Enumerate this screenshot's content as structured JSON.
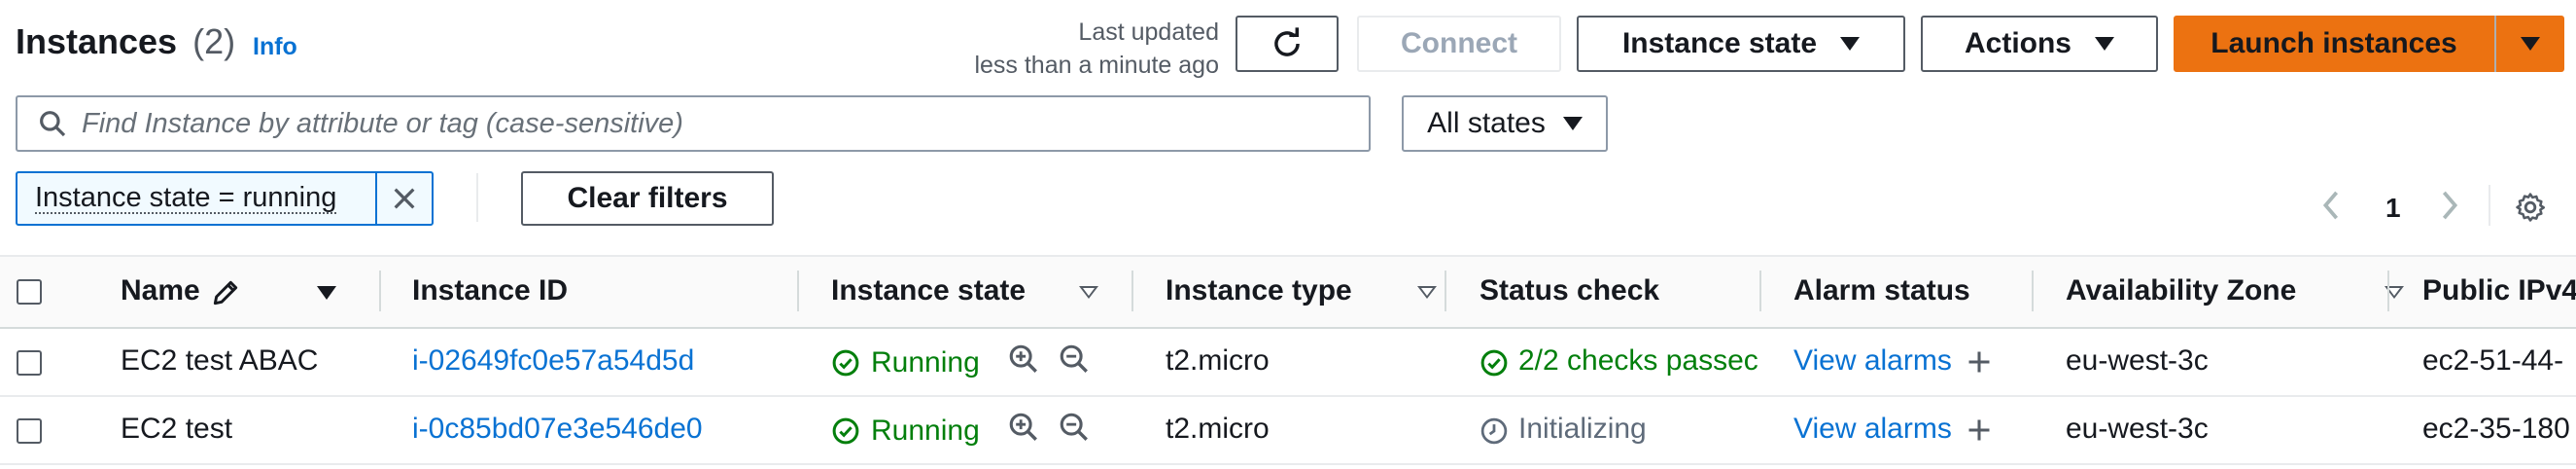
{
  "header": {
    "title": "Instances",
    "count": "(2)",
    "info": "Info",
    "last_updated_line1": "Last updated",
    "last_updated_line2": "less than a minute ago",
    "connect_label": "Connect",
    "instance_state_label": "Instance state",
    "actions_label": "Actions",
    "launch_label": "Launch instances"
  },
  "search": {
    "placeholder": "Find Instance by attribute or tag (case-sensitive)",
    "states_select": "All states"
  },
  "filters": {
    "token": "Instance state = running",
    "clear_label": "Clear filters"
  },
  "pagination": {
    "current_page": "1"
  },
  "table": {
    "columns": [
      "Name",
      "Instance ID",
      "Instance state",
      "Instance type",
      "Status check",
      "Alarm status",
      "Availability Zone",
      "Public IPv4"
    ],
    "rows": [
      {
        "name": "EC2 test ABAC",
        "instance_id": "i-02649fc0e57a54d5d",
        "state": "Running",
        "type": "t2.micro",
        "status_check": "2/2 checks passec",
        "alarm": "View alarms",
        "az": "eu-west-3c",
        "public_dns": "ec2-51-44-"
      },
      {
        "name": "EC2 test",
        "instance_id": "i-0c85bd07e3e546de0",
        "state": "Running",
        "type": "t2.micro",
        "status_check": "Initializing",
        "alarm": "View alarms",
        "az": "eu-west-3c",
        "public_dns": "ec2-35-180"
      }
    ]
  },
  "colors": {
    "primary": "#ec7211",
    "link": "#0972d3",
    "success": "#037f0c",
    "filter_token_bg": "#f1faff",
    "filter_token_border": "#0972d3"
  },
  "icons": [
    "refresh-icon",
    "caret-down-icon",
    "search-icon",
    "close-icon",
    "chevron-left-icon",
    "chevron-right-icon",
    "settings-icon",
    "edit-icon",
    "sort-icon",
    "check-circle-icon",
    "zoom-in-icon",
    "zoom-out-icon",
    "plus-icon",
    "clock-icon"
  ]
}
